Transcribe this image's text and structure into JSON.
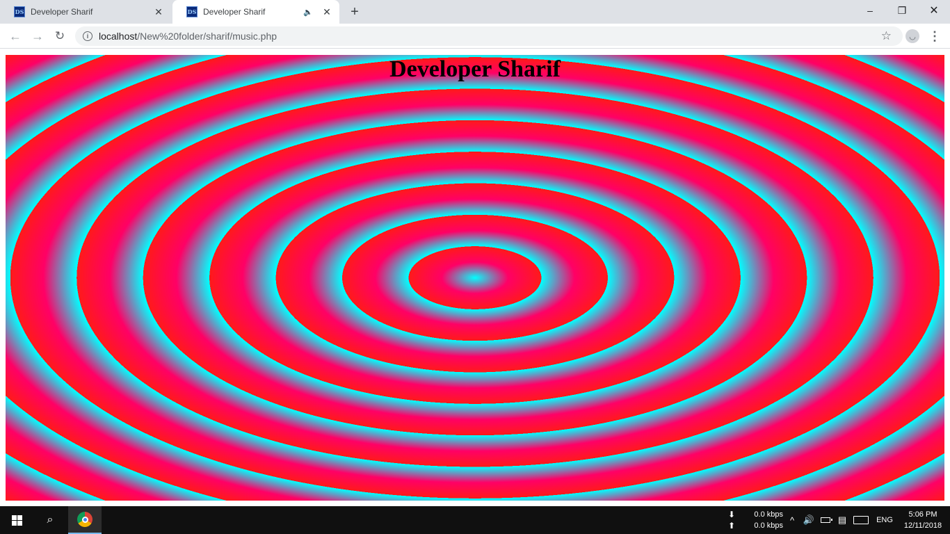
{
  "browser": {
    "tabs": [
      {
        "title": "Developer Sharif",
        "favicon_text": "DS",
        "active": false,
        "audio": false
      },
      {
        "title": "Developer Sharif",
        "favicon_text": "DS",
        "active": true,
        "audio": true
      }
    ],
    "tab_close_glyph": "✕",
    "new_tab_glyph": "+",
    "audio_glyph": "🔈",
    "window_controls": {
      "minimize": "–",
      "maximize": "❐",
      "close": "✕"
    },
    "nav": {
      "back": "←",
      "forward": "→",
      "reload": "↻"
    },
    "address_bar": {
      "host": "localhost",
      "path": "/New%20folder/sharif/music.php",
      "info_glyph": "i"
    },
    "bookmark_glyph": "☆",
    "profile_glyph": "◡",
    "menu_glyph": "⋮"
  },
  "page": {
    "heading": "Developer Sharif",
    "background_colors": [
      "#00ffff",
      "#ff0066",
      "#ff1a1a"
    ]
  },
  "taskbar": {
    "search_glyph": "⌕",
    "network": {
      "download_arrow": "⬇",
      "upload_arrow": "⬆",
      "download_speed": "0.0 kbps",
      "upload_speed": "0.0 kbps"
    },
    "tray_chevron": "^",
    "volume_glyph": "🔊",
    "notification_glyph": "▤",
    "language": "ENG",
    "time": "5:06 PM",
    "date": "12/11/2018"
  }
}
